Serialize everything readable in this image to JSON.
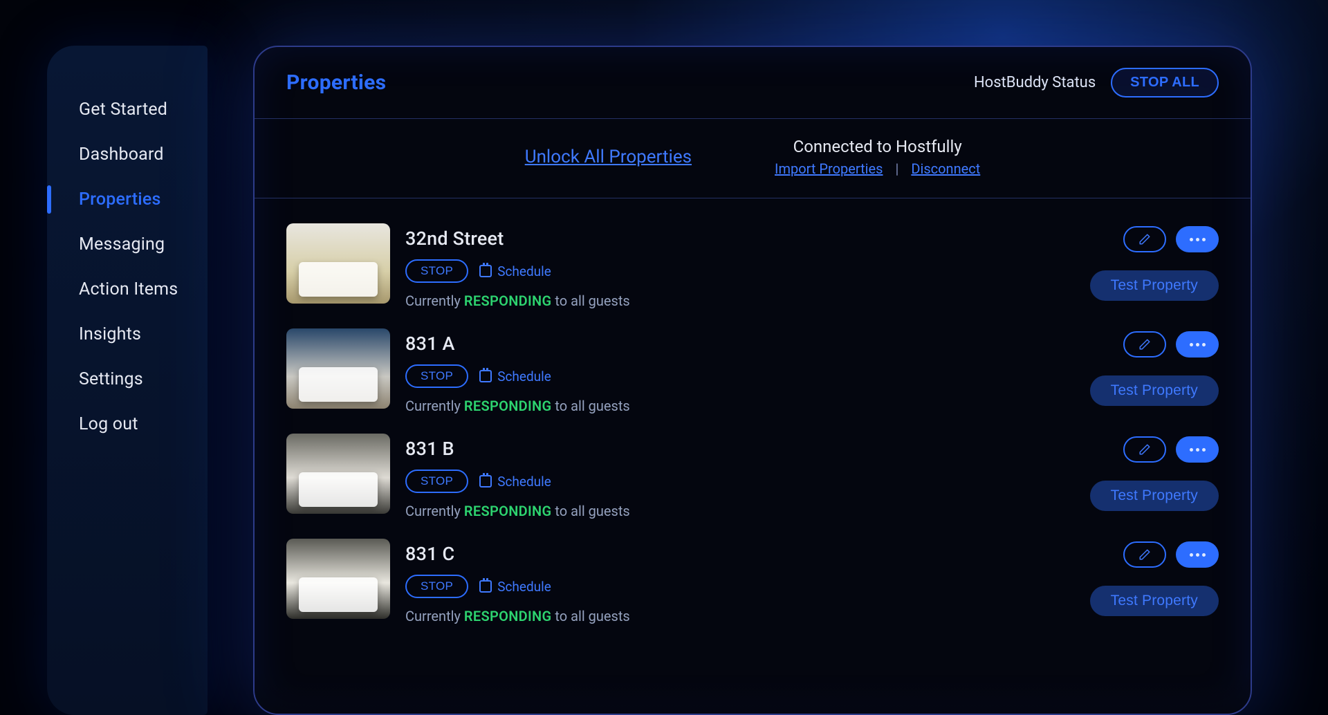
{
  "sidebar": {
    "items": [
      {
        "label": "Get Started",
        "active": false
      },
      {
        "label": "Dashboard",
        "active": false
      },
      {
        "label": "Properties",
        "active": true
      },
      {
        "label": "Messaging",
        "active": false
      },
      {
        "label": "Action Items",
        "active": false
      },
      {
        "label": "Insights",
        "active": false
      },
      {
        "label": "Settings",
        "active": false
      },
      {
        "label": "Log out",
        "active": false
      }
    ]
  },
  "header": {
    "title": "Properties",
    "status_label": "HostBuddy Status",
    "stop_all_label": "STOP ALL"
  },
  "subbar": {
    "unlock_label": "Unlock All Properties",
    "connection_title": "Connected to Hostfully",
    "import_label": "Import Properties",
    "disconnect_label": "Disconnect"
  },
  "status_strings": {
    "currently_prefix": "Currently ",
    "responding": "RESPONDING",
    "to_suffix": " to all guests",
    "stop_label": "STOP",
    "schedule_label": "Schedule",
    "test_label": "Test Property"
  },
  "colors": {
    "accent": "#2d6dff",
    "link": "#3f79ff",
    "success": "#2dd36f",
    "panel_border": "#2d3b8a"
  },
  "properties": [
    {
      "name": "32nd Street",
      "thumb_class": "bright"
    },
    {
      "name": "831 A",
      "thumb_class": "blue"
    },
    {
      "name": "831 B",
      "thumb_class": "grey"
    },
    {
      "name": "831 C",
      "thumb_class": "grey2"
    }
  ]
}
